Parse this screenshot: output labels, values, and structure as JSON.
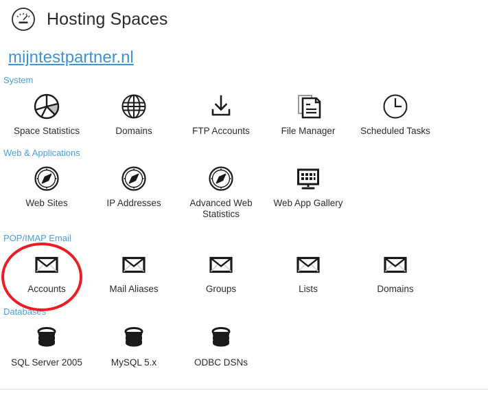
{
  "header": {
    "icon": "gauge-icon",
    "title": "Hosting Spaces"
  },
  "space_link": {
    "label": "mijntestpartner.nl"
  },
  "sections": [
    {
      "title": "System",
      "items": [
        {
          "label": "Space Statistics",
          "icon": "pie-chart-icon"
        },
        {
          "label": "Domains",
          "icon": "globe-icon"
        },
        {
          "label": "FTP Accounts",
          "icon": "download-tray-icon"
        },
        {
          "label": "File Manager",
          "icon": "documents-icon"
        },
        {
          "label": "Scheduled Tasks",
          "icon": "clock-icon"
        }
      ]
    },
    {
      "title": "Web & Applications",
      "items": [
        {
          "label": "Web Sites",
          "icon": "compass-icon"
        },
        {
          "label": "IP Addresses",
          "icon": "compass-icon"
        },
        {
          "label": "Advanced Web\nStatistics",
          "icon": "compass-icon"
        },
        {
          "label": "Web App Gallery",
          "icon": "monitor-grid-icon"
        }
      ]
    },
    {
      "title": "POP/IMAP Email",
      "items": [
        {
          "label": "Accounts",
          "icon": "envelope-icon"
        },
        {
          "label": "Mail Aliases",
          "icon": "envelope-icon"
        },
        {
          "label": "Groups",
          "icon": "envelope-icon"
        },
        {
          "label": "Lists",
          "icon": "envelope-icon"
        },
        {
          "label": "Domains",
          "icon": "envelope-icon"
        }
      ]
    },
    {
      "title": "Databases",
      "items": [
        {
          "label": "SQL Server 2005",
          "icon": "database-icon"
        },
        {
          "label": "MySQL 5.x",
          "icon": "database-icon"
        },
        {
          "label": "ODBC DSNs",
          "icon": "database-icon"
        }
      ]
    }
  ],
  "annotation": {
    "shape": "circle",
    "target": "Accounts",
    "color": "#ee1c24"
  },
  "colors": {
    "link": "#3b93d9",
    "section_title": "#4a9ee0",
    "text": "#2b2b2b",
    "annotation": "#ee1c24",
    "rule": "#dcdcdc"
  }
}
